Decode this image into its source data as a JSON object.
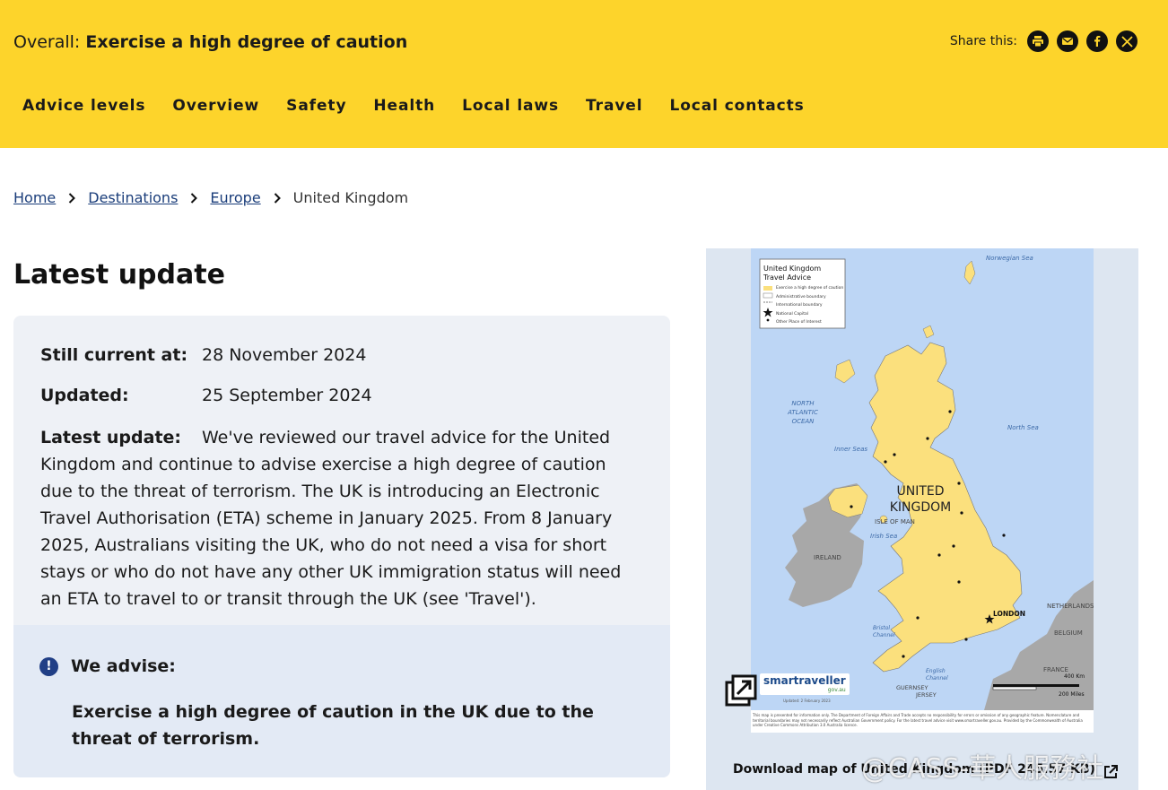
{
  "header": {
    "overall_label": "Overall:",
    "overall_level": "Exercise a high degree of caution",
    "share_label": "Share this:",
    "share_icons": [
      "printer-icon",
      "mail-icon",
      "facebook-icon",
      "x-icon"
    ],
    "nav": [
      "Advice levels",
      "Overview",
      "Safety",
      "Health",
      "Local laws",
      "Travel",
      "Local contacts"
    ],
    "colors": {
      "background": "#fdd42b"
    }
  },
  "breadcrumb": {
    "items": [
      "Home",
      "Destinations",
      "Europe"
    ],
    "current": "United Kingdom"
  },
  "main": {
    "title": "Latest update",
    "still_current_label": "Still current at:",
    "still_current_value": "28 November 2024",
    "updated_label": "Updated:",
    "updated_value": "25 September 2024",
    "latest_update_label": "Latest update:",
    "latest_update_text": "We've reviewed our travel advice for the United Kingdom and continue to advise exercise a high degree of caution due to the threat of terrorism. The UK is introducing an Electronic Travel Authorisation (ETA) scheme in January 2025. From 8 January 2025, Australians visiting the UK, who do not need a visa for short stays or who do not have any other UK immigration status will need an ETA to travel to or transit through the UK (see 'Travel').",
    "advise_label": "We advise:",
    "advise_text": "Exercise a high degree of caution in the UK due to the threat of terrorism."
  },
  "map": {
    "legend_title": "United Kingdom",
    "legend_subtitle": "Travel Advice",
    "legend_items": [
      "Exercise a high degree of caution",
      "Administrative boundary",
      "International boundary",
      "National Capital",
      "Other Place of Interest"
    ],
    "labels": {
      "norwegian_sea": "Norwegian Sea",
      "north_atlantic": "NORTH ATLANTIC OCEAN",
      "north_sea": "North Sea",
      "inner_seas": "Inner Seas",
      "uk": "UNITED KINGDOM",
      "isle_of_man": "ISLE OF MAN",
      "irish_sea": "Irish Sea",
      "ireland": "IRELAND",
      "london": "LONDON",
      "netherlands": "NETHERLANDS",
      "belgium": "BELGIUM",
      "france": "FRANCE",
      "guernsey": "GUERNSEY",
      "jersey": "JERSEY",
      "english_channel": "English Channel",
      "bristol_channel": "Bristol Channel",
      "scale_km": "400 Km",
      "scale_miles": "200 Miles"
    },
    "brand": "smartraveller",
    "brand_sub": "gov.au",
    "updated_note": "Updated: 2 February 2023",
    "disclaimer": "This map is presented for information only. The Department of Foreign Affairs and Trade accepts no responsibility for errors or omission of any geographic feature. Nomenclature and territorial boundaries may not necessarily reflect Australian Government policy. For the latest travel advice visit www.smartraveller.gov.au. Provided by the Commonwealth of Australia under Creative Commons Attribution 3.0 Australia licence.",
    "colors": {
      "sea": "#bdd6f5",
      "uk": "#fbe07d",
      "land": "#a8a8a8"
    }
  },
  "download_label": "Download map of United Kingdom (PDF 245.57 KB)",
  "watermark": "@CASS-華人服務社"
}
